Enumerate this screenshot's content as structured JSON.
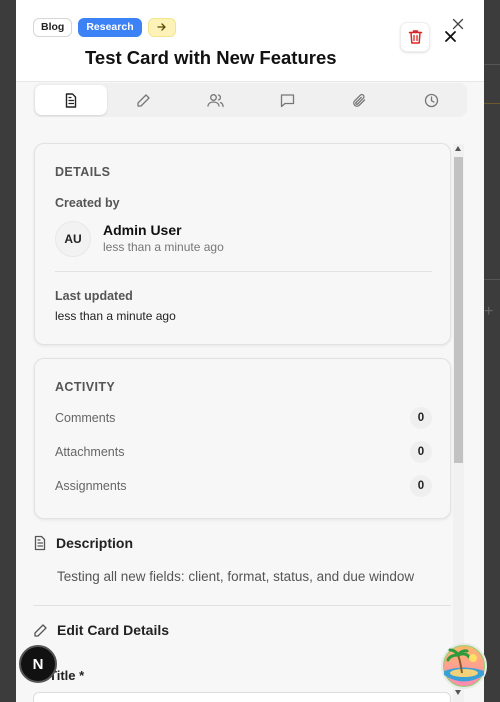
{
  "card": {
    "tags": [
      "Blog",
      "Research"
    ],
    "arrow_tag_icon": "arrow-right-icon",
    "title": "Test Card with New Features"
  },
  "tabs": [
    {
      "icon": "document-icon",
      "active": true
    },
    {
      "icon": "pencil-icon",
      "active": false
    },
    {
      "icon": "users-icon",
      "active": false
    },
    {
      "icon": "comment-icon",
      "active": false
    },
    {
      "icon": "paperclip-icon",
      "active": false
    },
    {
      "icon": "clock-icon",
      "active": false
    }
  ],
  "details": {
    "heading": "DETAILS",
    "created_by_label": "Created by",
    "avatar_initials": "AU",
    "user_name": "Admin User",
    "created_time": "less than a minute ago",
    "last_updated_label": "Last updated",
    "last_updated_value": "less than a minute ago"
  },
  "activity": {
    "heading": "ACTIVITY",
    "rows": [
      {
        "label": "Comments",
        "count": "0"
      },
      {
        "label": "Attachments",
        "count": "0"
      },
      {
        "label": "Assignments",
        "count": "0"
      }
    ]
  },
  "description": {
    "heading": "Description",
    "text": "Testing all new fields: client, format, status, and due window"
  },
  "edit": {
    "heading": "Edit Card Details",
    "title_label": "Title *"
  },
  "floating": {
    "n_badge": "N"
  },
  "colors": {
    "accent_blue": "#3b82f6",
    "delete_red": "#dc2626",
    "arrow_tag_bg": "#fdf3b8"
  }
}
